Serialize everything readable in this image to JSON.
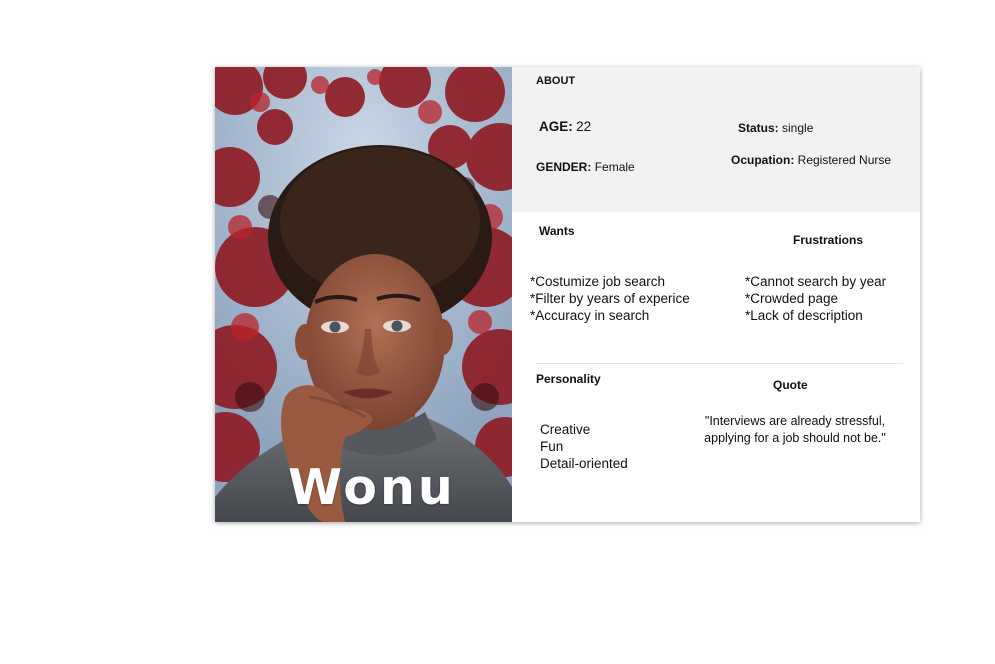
{
  "persona": {
    "name": "Wonu",
    "photo_icon": "portrait-photo"
  },
  "about": {
    "heading": "ABOUT",
    "age_label": "AGE:",
    "age_value": "22",
    "status_label": "Status:",
    "status_value": "single",
    "gender_label": "GENDER:",
    "gender_value": "Female",
    "occupation_label": "Ocupation:",
    "occupation_value": "Registered Nurse"
  },
  "wants": {
    "heading": "Wants",
    "items": [
      "*Costumize job search",
      "*Filter by years of experice",
      "*Accuracy in search"
    ]
  },
  "frustrations": {
    "heading": "Frustrations",
    "items": [
      "*Cannot search by year",
      "*Crowded page",
      "*Lack of description"
    ]
  },
  "personality": {
    "heading": "Personality",
    "items": [
      "Creative",
      "Fun",
      "Detail-oriented"
    ]
  },
  "quote": {
    "heading": "Quote",
    "lines": [
      "\"Interviews are already stressful,",
      "applying for a job should not be.\""
    ]
  },
  "colors": {
    "about_bg": "#f2f2f2",
    "photo_foliage": "#8e1a22",
    "text": "#111111"
  }
}
